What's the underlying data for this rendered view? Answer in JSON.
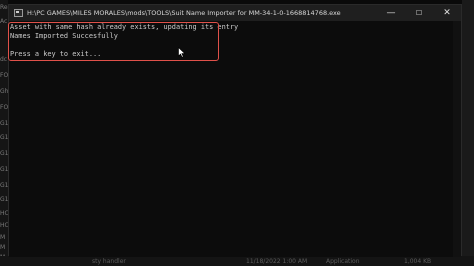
{
  "window": {
    "title": "H:\\PC GAMES\\MILES MORALES\\mods\\TOOLS\\Suit Name Importer for MM-34-1-0-1668814768.exe",
    "minimize_glyph": "—",
    "maximize_glyph": "☐",
    "close_glyph": "✕"
  },
  "console": {
    "lines": [
      "Asset with same hash already exists, updating its entry",
      "Names Imported Succesfully",
      "",
      "Press a key to exit..."
    ]
  },
  "background": {
    "left_labels": [
      "Re",
      "Ac",
      "dc",
      "FO",
      "Gh",
      "FO",
      "G1",
      "G1",
      "G1",
      "G1",
      "G1",
      "G1",
      "HC",
      "HC",
      "M",
      "M",
      "M"
    ],
    "bottom_row": {
      "name": "sty handler",
      "date": "11/18/2022 1:00 AM",
      "type": "Application",
      "size": "1,004 KB"
    }
  },
  "colors": {
    "highlight": "#e0514a",
    "console_text": "#cccccc",
    "console_bg": "#0c0c0c",
    "titlebar_bg": "#1f1f1f"
  }
}
